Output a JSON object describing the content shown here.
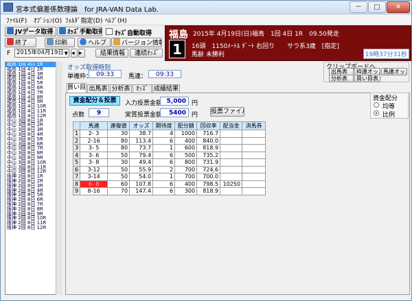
{
  "window": {
    "title": "宮本式偏差係数理論　for JRA-VAN Data Lab.",
    "min": "－",
    "max": "□",
    "close": "✕"
  },
  "menu": [
    "ﾌｧｲﾙ(F)",
    "ｵﾌﾟｼｮﾝ(O)",
    "ﾌｫﾙﾀﾞ指定(D)",
    "ﾍﾙﾌﾟ(H)"
  ],
  "toolbar": {
    "jv": "JVデータ取得",
    "odds_manual": "ｵｯｽﾞ手動取得",
    "odds_auto": "ｵｯｽﾞ自動取得",
    "exit": "終了",
    "print": "印刷",
    "help": "ヘルプ",
    "version": "バージョン情報",
    "filter_label": "F",
    "date": "2015年04月19日",
    "prev": "◀",
    "next": "▶",
    "result": "結果情報",
    "renmaku": "連続ｵｯｽﾞ"
  },
  "race": {
    "venue": "福島",
    "header": "2015年 4月19日(日)福島　1回 4日 1R　09.50発走",
    "number": "1",
    "line2": "16頭　1150ﾒｰﾄﾙ ﾀﾞｰﾄ 右回り　　サラ系3歳　[指定]",
    "line3": "馬齢 未勝利",
    "time": "19時37分31秒"
  },
  "races": [
    "福島 1回 4日 1R",
    "福島 1回 4日 2R",
    "福島 1回 4日 3R",
    "福島 1回 4日 4R",
    "福島 1回 4日 5R",
    "福島 1回 4日 6R",
    "福島 1回 4日 7R",
    "福島 1回 4日 8R",
    "福島 1回 4日 9R",
    "福島 1回 4日 10R",
    "福島 1回 4日 11R",
    "福島 1回 4日 12R",
    "中山 3回 8日 1R",
    "中山 3回 8日 2R",
    "中山 3回 8日 3R",
    "中山 3回 8日 4R",
    "中山 3回 8日 5R",
    "中山 3回 8日 6R",
    "中山 3回 8日 7R",
    "中山 3回 8日 8R",
    "中山 3回 8日 9R",
    "中山 3回 8日 10R",
    "中山 3回 8日 11R",
    "中山 3回 8日 12R",
    "阪神 2回 8日 1R",
    "阪神 2回 8日 2R",
    "阪神 2回 8日 3R",
    "阪神 2回 8日 4R",
    "阪神 2回 8日 5R",
    "阪神 2回 8日 6R",
    "阪神 2回 8日 7R",
    "阪神 2回 8日 8R",
    "阪神 2回 8日 9R",
    "阪神 2回 8日 10R",
    "阪神 2回 8日 11R",
    "阪神 2回 8日 12R"
  ],
  "odds_time": {
    "title": "オッズ取得時刻",
    "tansho_label": "単複枠：",
    "tansho_value": "09:33",
    "umaren_label": "馬連：",
    "umaren_value": "09:33"
  },
  "clipboard": {
    "title": "クリップボードへ",
    "b1": "出馬表",
    "b2": "枠連オッズ",
    "b3": "馬連オッズ",
    "b4": "分析表",
    "b5": "買い目表"
  },
  "tabs": [
    "買い目",
    "出馬表",
    "分析表",
    "ｵｯｽﾞ",
    "成績結果"
  ],
  "alloc_button": "資金配分＆投票",
  "input_total_label": "入力投票金額",
  "input_total": "5,000",
  "unit1": "円",
  "points_label": "点数",
  "points": "9",
  "actual_total_label": "実質投票金額",
  "actual_total": "5400",
  "unit2": "円",
  "vote_file": "投票ファイル",
  "alloc_group": {
    "title": "資金配分",
    "opt1": "均等",
    "opt2": "比例"
  },
  "table": {
    "headers": [
      "",
      "馬連",
      "連複値",
      "オッズ",
      "期待度",
      "配分額",
      "回収率",
      "配当金",
      "消馬券"
    ],
    "rows": [
      [
        "1",
        "2- 3",
        "30",
        "38.7",
        "4",
        "1000",
        "716.7",
        "",
        ""
      ],
      [
        "2",
        "2-16",
        "80",
        "113.4",
        "6",
        "400",
        "840.0",
        "",
        ""
      ],
      [
        "3",
        "3- 5",
        "80",
        "73.7",
        "1",
        "600",
        "818.9",
        "",
        ""
      ],
      [
        "4",
        "3- 6",
        "50",
        "79.4",
        "6",
        "500",
        "735.2",
        "",
        ""
      ],
      [
        "5",
        "3- 8",
        "30",
        "49.4",
        "6",
        "800",
        "731.9",
        "",
        ""
      ],
      [
        "6",
        "3-12",
        "50",
        "55.9",
        "2",
        "700",
        "724.6",
        "",
        ""
      ],
      [
        "7",
        "3-14",
        "50",
        "54.0",
        "1",
        "700",
        "700.0",
        "",
        ""
      ],
      [
        "8",
        "6- 8",
        "60",
        "107.8",
        "6",
        "400",
        "798.5",
        "10250",
        ""
      ],
      [
        "9",
        "8-16",
        "70",
        "147.4",
        "6",
        "300",
        "818.9",
        "",
        ""
      ]
    ]
  }
}
